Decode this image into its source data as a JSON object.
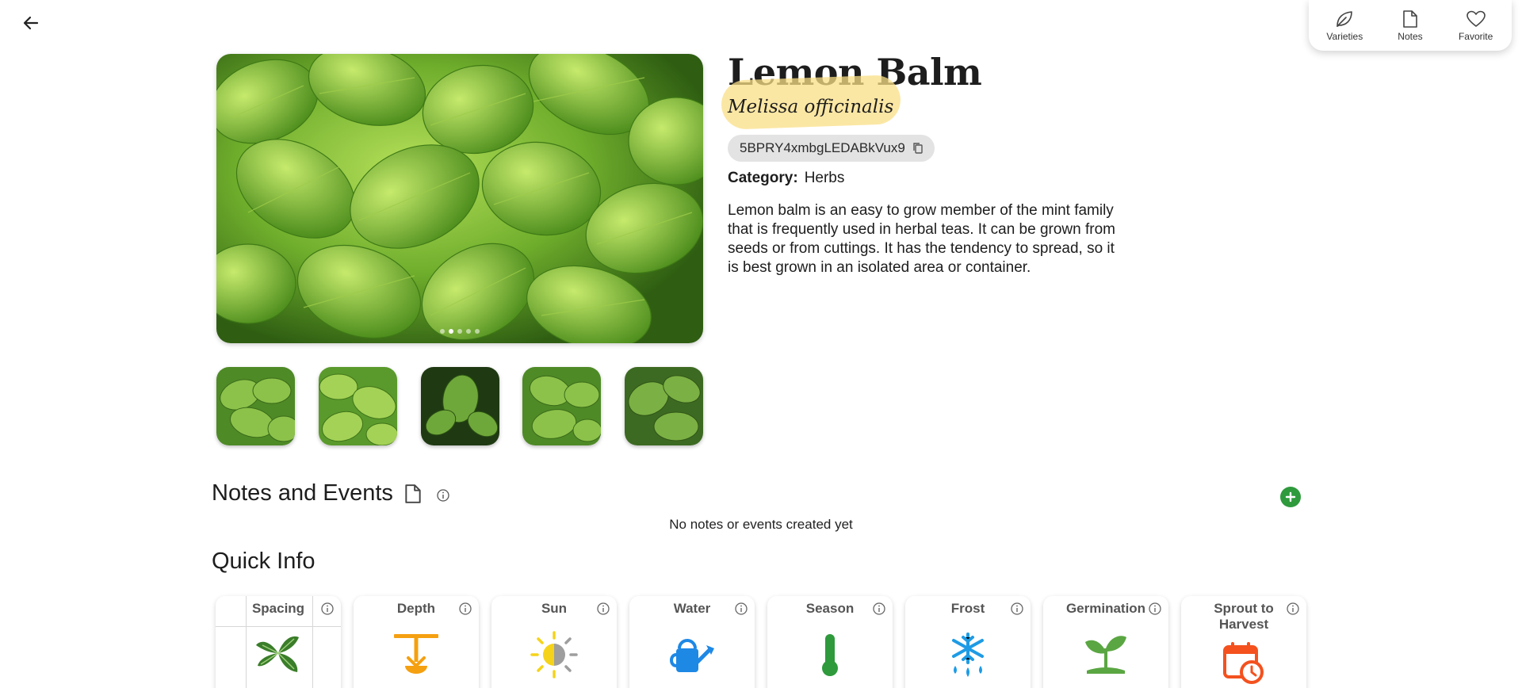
{
  "nav": {
    "back_label": "Back"
  },
  "top_actions": [
    {
      "label": "Varieties",
      "icon": "leaf-icon"
    },
    {
      "label": "Notes",
      "icon": "document-icon"
    },
    {
      "label": "Favorite",
      "icon": "heart-icon"
    }
  ],
  "plant": {
    "name": "Lemon Balm",
    "scientific_name": "Melissa officinalis",
    "id": "5BPRY4xmbgLEDABkVux9",
    "category_label": "Category:",
    "category": "Herbs",
    "description": "Lemon balm is an easy to grow member of the mint family that is frequently used in herbal teas. It can be grown from seeds or from cuttings. It has the tendency to spread, so it is best grown in an isolated area or container."
  },
  "gallery": {
    "image_count": 5,
    "active_index": 1
  },
  "notes": {
    "title": "Notes and Events",
    "empty_text": "No notes or events created yet"
  },
  "quick_info": {
    "title": "Quick Info",
    "cards": [
      {
        "label": "Spacing",
        "icon": "spacing-leaf-icon"
      },
      {
        "label": "Depth",
        "icon": "depth-icon"
      },
      {
        "label": "Sun",
        "icon": "sun-icon"
      },
      {
        "label": "Water",
        "icon": "watering-can-icon"
      },
      {
        "label": "Season",
        "icon": "thermometer-icon"
      },
      {
        "label": "Frost",
        "icon": "snowflake-icon"
      },
      {
        "label": "Germination",
        "icon": "sprout-icon"
      },
      {
        "label": "Sprout to Harvest",
        "icon": "calendar-clock-icon"
      }
    ]
  },
  "colors": {
    "accent_green": "#2e9a3c",
    "highlight_yellow": "#f9df86",
    "depth_orange": "#f5a010",
    "water_blue": "#1e88e5",
    "harvest_red": "#f4511e"
  }
}
